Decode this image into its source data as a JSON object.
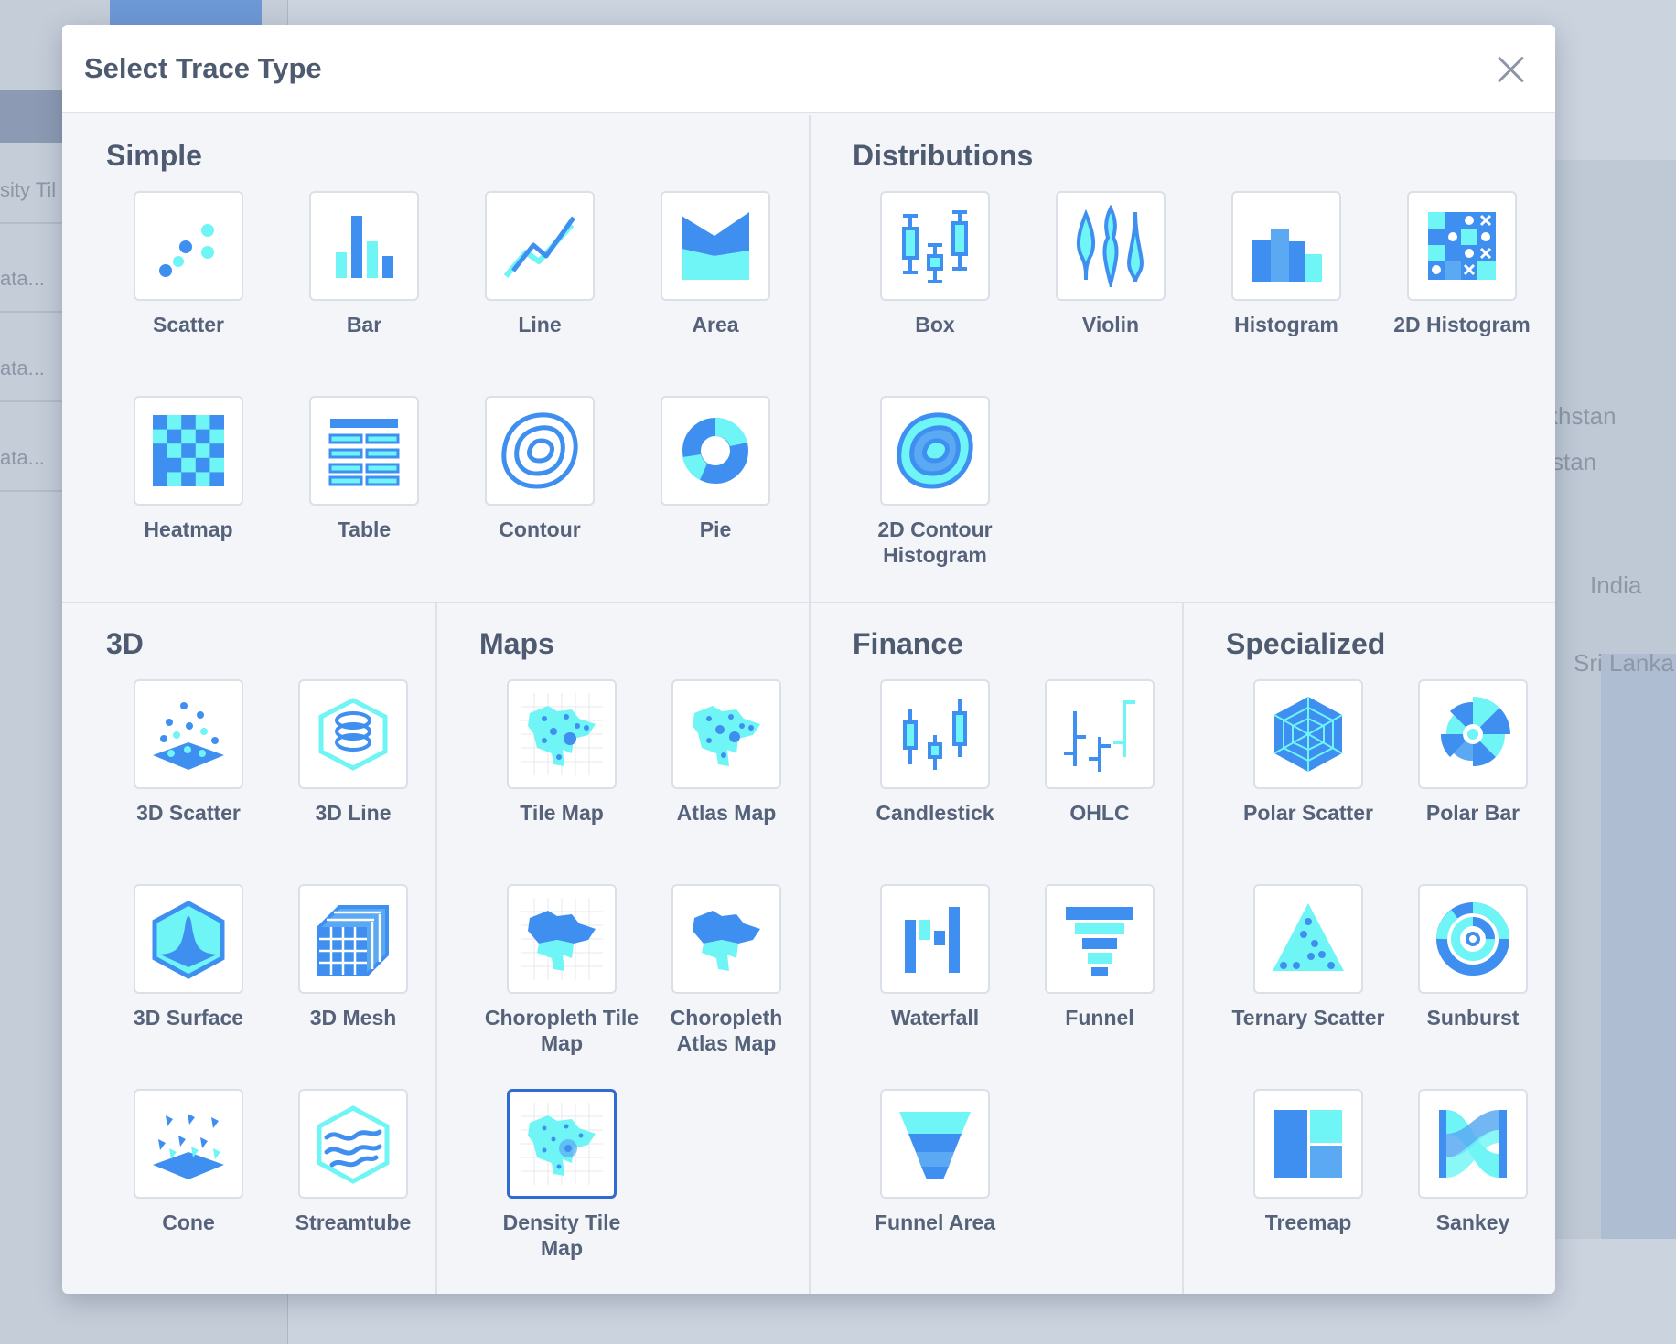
{
  "background": {
    "left_texts": [
      "sity Til",
      "ata...",
      "ata...",
      "ata..."
    ],
    "map_labels": [
      "khstan",
      "stan",
      "India",
      "Sri Lanka"
    ]
  },
  "modal": {
    "title": "Select Trace Type",
    "close_label": "×"
  },
  "sections": {
    "simple": "Simple",
    "distributions": "Distributions",
    "three_d": "3D",
    "maps": "Maps",
    "finance": "Finance",
    "specialized": "Specialized"
  },
  "items": {
    "scatter": "Scatter",
    "bar": "Bar",
    "line": "Line",
    "area": "Area",
    "heatmap": "Heatmap",
    "table": "Table",
    "contour": "Contour",
    "pie": "Pie",
    "box": "Box",
    "violin": "Violin",
    "histogram": "Histogram",
    "histogram_2d": "2D Histogram",
    "contour_histogram_2d": "2D Contour Histogram",
    "scatter_3d": "3D Scatter",
    "line_3d": "3D Line",
    "surface_3d": "3D Surface",
    "mesh_3d": "3D Mesh",
    "cone": "Cone",
    "streamtube": "Streamtube",
    "tile_map": "Tile Map",
    "atlas_map": "Atlas Map",
    "choropleth_tile_map": "Choropleth Tile Map",
    "choropleth_atlas_map": "Choropleth Atlas Map",
    "density_tile_map": "Density Tile Map",
    "candlestick": "Candlestick",
    "ohlc": "OHLC",
    "waterfall": "Waterfall",
    "funnel": "Funnel",
    "funnel_area": "Funnel Area",
    "polar_scatter": "Polar Scatter",
    "polar_bar": "Polar Bar",
    "ternary_scatter": "Ternary Scatter",
    "sunburst": "Sunburst",
    "treemap": "Treemap",
    "sankey": "Sankey"
  },
  "selected_item": "Density Tile Map",
  "colors": {
    "dark_blue": "#3f8ff0",
    "light_cyan": "#6ff5f5",
    "mid_blue": "#5aa9f2",
    "title_text": "#4d5a70",
    "selected_border": "#2f6cd1"
  }
}
